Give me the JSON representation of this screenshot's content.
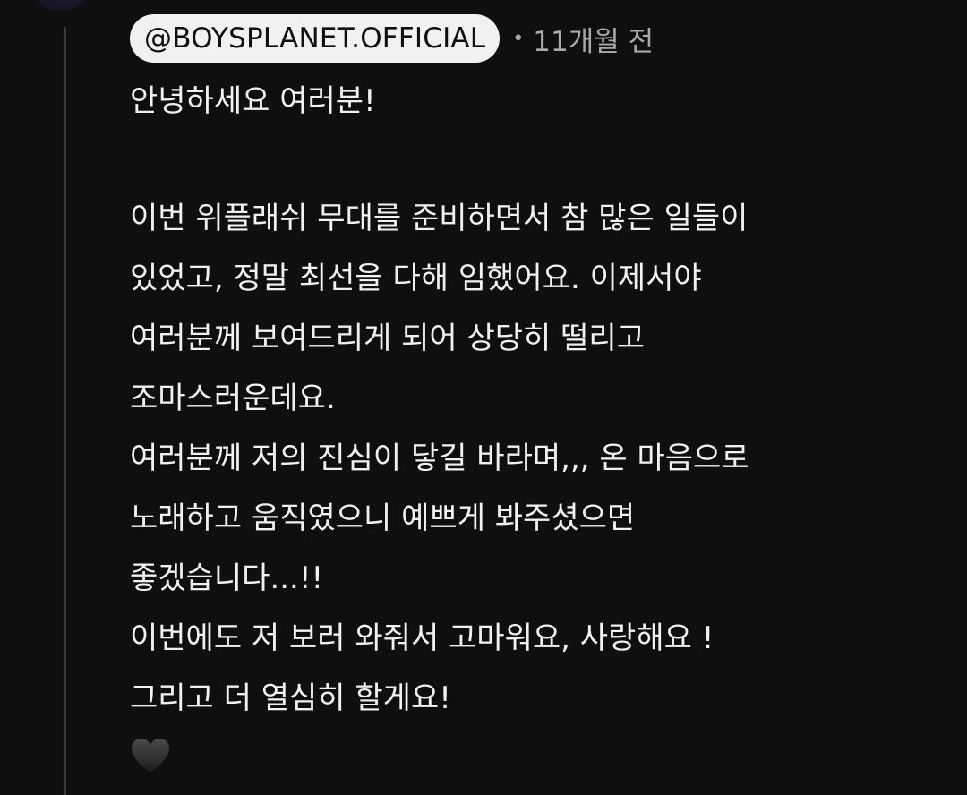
{
  "comment": {
    "author": "@BOYSPLANET.OFFICIAL",
    "separator": "•",
    "timestamp": "11개월 전",
    "lines": [
      "안녕하세요 여러분!",
      "이번 위플래쉬 무대를 준비하면서 참 많은 일들이",
      "있었고, 정말 최선을 다해 임했어요. 이제서야",
      "여러분께 보여드리게 되어 상당히 떨리고",
      "조마스러운데요.",
      "여러분께 저의 진심이 닿길 바라며,,, 온 마음으로",
      "노래하고 움직였으니 예쁘게 봐주셨으면",
      "좋겠습니다...!!",
      "이번에도 저 보러 와줘서 고마워요, 사랑해요 !",
      "그리고 더 열심히 할게요!"
    ],
    "emoji": "black-heart-icon"
  },
  "colors": {
    "background": "#0f0f0f",
    "text": "#f1f1f1",
    "secondary_text": "#aaaaaa",
    "pill_background": "#f1f1f1",
    "thread_line": "#3a3a3a"
  }
}
